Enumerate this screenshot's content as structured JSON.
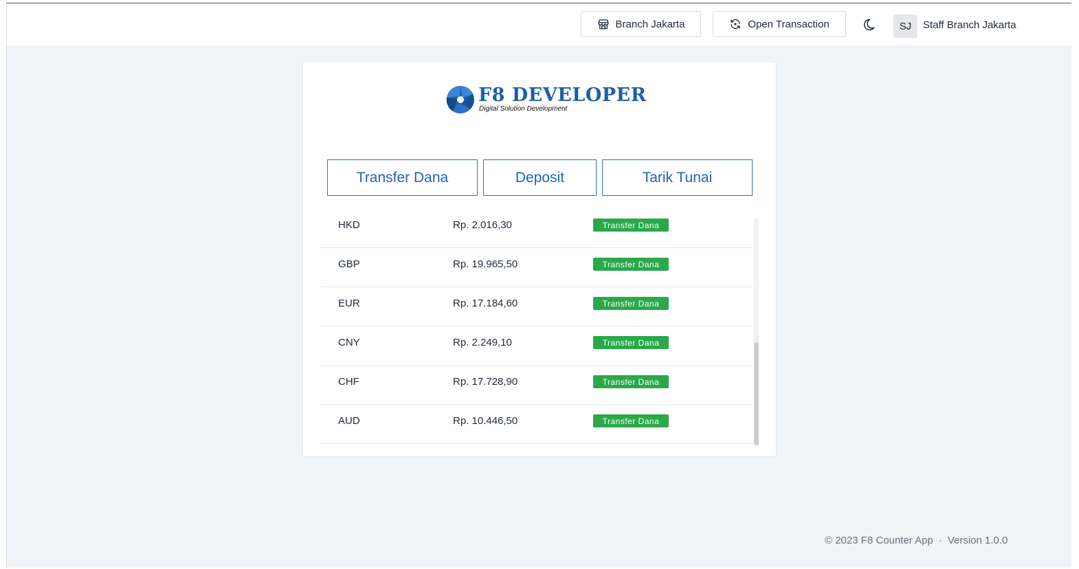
{
  "header": {
    "branch_label": "Branch Jakarta",
    "open_transaction_label": "Open Transaction",
    "user_initials": "SJ",
    "user_name": "Staff Branch Jakarta",
    "icons": [
      "store-icon",
      "refresh-icon",
      "moon-icon"
    ]
  },
  "logo": {
    "main_text": "F8 DEVELOPER",
    "sub_text": "Digital Solution Development",
    "brand_color": "#1d5fa8"
  },
  "tabs": [
    {
      "label": "Transfer Dana"
    },
    {
      "label": "Deposit"
    },
    {
      "label": "Tarik Tunai"
    }
  ],
  "rates": [
    {
      "currency": "HKD",
      "rate": "Rp. 2.016,30",
      "badge": "Transfer Dana"
    },
    {
      "currency": "GBP",
      "rate": "Rp. 19.965,50",
      "badge": "Transfer Dana"
    },
    {
      "currency": "EUR",
      "rate": "Rp. 17.184,60",
      "badge": "Transfer Dana"
    },
    {
      "currency": "CNY",
      "rate": "Rp. 2.249,10",
      "badge": "Transfer Dana"
    },
    {
      "currency": "CHF",
      "rate": "Rp. 17.728,90",
      "badge": "Transfer Dana"
    },
    {
      "currency": "AUD",
      "rate": "Rp. 10.446,50",
      "badge": "Transfer Dana"
    }
  ],
  "footer": {
    "copyright": "© 2023 F8 Counter App",
    "separator": "·",
    "version": "Version 1.0.0"
  },
  "colors": {
    "accent": "#1f63b6",
    "badge_green": "#2aa84a",
    "background": "#f0f3f8"
  }
}
